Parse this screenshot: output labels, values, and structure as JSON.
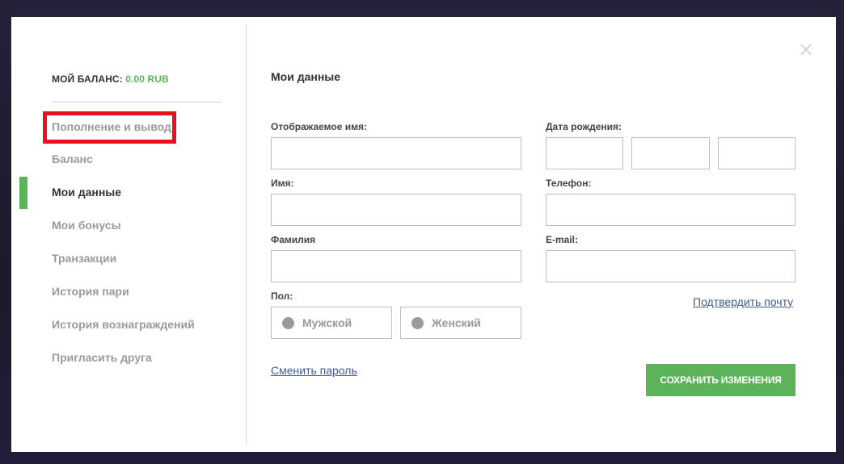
{
  "sidebar": {
    "balance_label": "МОЙ БАЛАНС:",
    "balance_amount": "0.00 RUB",
    "items": [
      {
        "label": "Пополнение и вывод"
      },
      {
        "label": "Баланс"
      },
      {
        "label": "Мои данные"
      },
      {
        "label": "Мои бонусы"
      },
      {
        "label": "Транзакции"
      },
      {
        "label": "История пари"
      },
      {
        "label": "История вознаграждений"
      },
      {
        "label": "Пригласить друга"
      }
    ]
  },
  "main": {
    "title": "Мои данные",
    "fields": {
      "display_name": {
        "label": "Отображаемое имя:",
        "value": ""
      },
      "first_name": {
        "label": "Имя:",
        "value": ""
      },
      "last_name": {
        "label": "Фамилия",
        "value": ""
      },
      "birth_date": {
        "label": "Дата рождения:",
        "day": "",
        "month": "",
        "year": ""
      },
      "phone": {
        "label": "Телефон:",
        "value": ""
      },
      "email": {
        "label": "E-mail:",
        "value": ""
      }
    },
    "gender": {
      "label": "Пол:",
      "options": [
        {
          "label": "Мужской"
        },
        {
          "label": "Женский"
        }
      ]
    },
    "confirm_email_link": "Подтвердить почту",
    "change_password_link": "Сменить пароль",
    "save_button": "СОХРАНИТЬ ИЗМЕНЕНИЯ",
    "close_icon": "close-icon"
  },
  "colors": {
    "accent_green": "#5db35a",
    "highlight_red": "#e8101e",
    "link_blue": "#3f5c8c"
  }
}
